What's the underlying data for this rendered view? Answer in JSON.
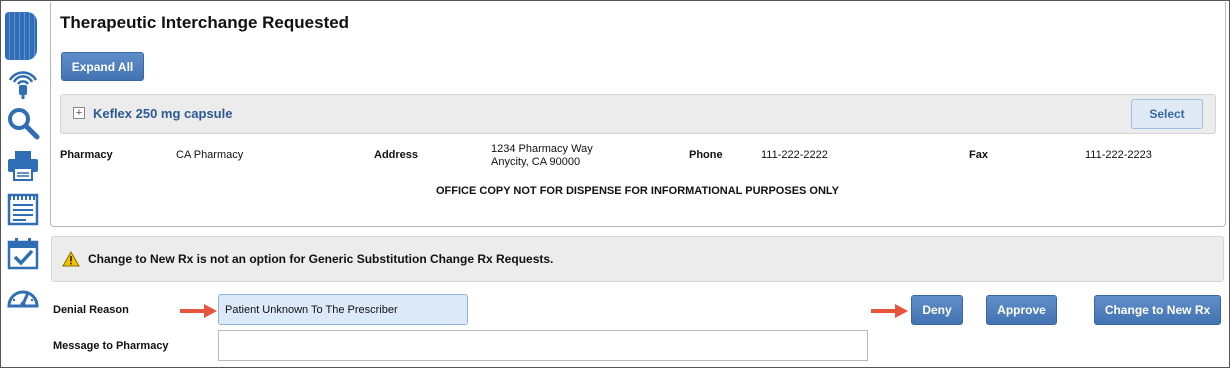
{
  "page": {
    "title": "Therapeutic Interchange Requested"
  },
  "sidebar": {
    "icons": [
      "menu-tab-icon",
      "rfid-tag-icon",
      "search-icon",
      "printer-icon",
      "notepad-icon",
      "calendar-check-icon",
      "gauge-icon"
    ]
  },
  "actions": {
    "expand_all": "Expand All"
  },
  "medication": {
    "name": "Keflex 250 mg capsule",
    "select_label": "Select"
  },
  "pharmacy": {
    "pharmacy_label": "Pharmacy",
    "pharmacy_value": "CA Pharmacy",
    "address_label": "Address",
    "address_line1": "1234 Pharmacy Way",
    "address_line2": "Anycity, CA 90000",
    "phone_label": "Phone",
    "phone_value": "111-222-2222",
    "fax_label": "Fax",
    "fax_value": "111-222-2223"
  },
  "notice": "OFFICE COPY NOT FOR DISPENSE FOR INFORMATIONAL PURPOSES ONLY",
  "warning": {
    "text": "Change to New Rx is not an option for Generic Substitution Change Rx Requests."
  },
  "form": {
    "denial_reason_label": "Denial Reason",
    "denial_reason_value": "Patient Unknown To The Prescriber",
    "message_label": "Message to Pharmacy",
    "message_value": ""
  },
  "buttons": {
    "deny": "Deny",
    "approve": "Approve",
    "change_new_rx": "Change to New Rx"
  },
  "colors": {
    "accent": "#4a78b7",
    "annotation_arrow": "#e8553f",
    "warning_icon": "#f2c200"
  }
}
